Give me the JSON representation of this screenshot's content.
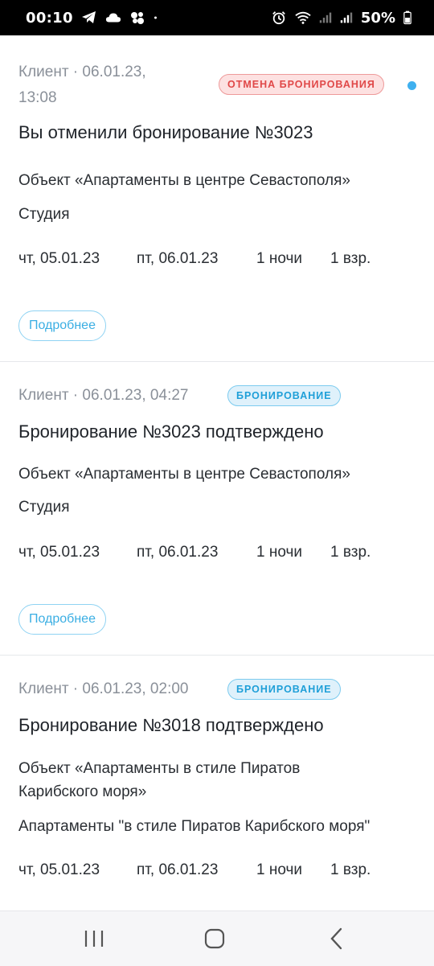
{
  "status_bar": {
    "time": "00:10",
    "battery": "50%",
    "left_icons": [
      "telegram-icon",
      "cloud-icon",
      "app-icon",
      "dot-icon"
    ],
    "right_icons": [
      "alarm-icon",
      "wifi-icon",
      "signal-icon",
      "signal-icon",
      "battery-icon"
    ]
  },
  "notifications": [
    {
      "meta": "Клиент · 06.01.23,",
      "meta_line2": "13:08",
      "badge": "ОТМЕНА БРОНИРОВАНИЯ",
      "badge_type": "cancel",
      "unread": true,
      "title": "Вы отменили бронирование №3023",
      "object": "Объект «Апартаменты в центре Севастополя»",
      "room": "Студия",
      "check_in": "чт, 05.01.23",
      "check_out": "пт, 06.01.23",
      "nights": "1 ночи",
      "guests": "1 взр.",
      "more_label": "Подробнее"
    },
    {
      "meta": "Клиент · 06.01.23, 04:27",
      "badge": "БРОНИРОВАНИЕ",
      "badge_type": "booking",
      "unread": false,
      "title": "Бронирование №3023 подтверждено",
      "object": "Объект «Апартаменты в центре Севастополя»",
      "room": "Студия",
      "check_in": "чт, 05.01.23",
      "check_out": "пт, 06.01.23",
      "nights": "1 ночи",
      "guests": "1 взр.",
      "more_label": "Подробнее"
    },
    {
      "meta": "Клиент · 06.01.23, 02:00",
      "badge": "БРОНИРОВАНИЕ",
      "badge_type": "booking",
      "unread": false,
      "title": "Бронирование №3018 подтверждено",
      "object": "Объект «Апартаменты в стиле Пиратов Карибского моря»",
      "room": "Апартаменты \"в стиле Пиратов Карибского моря\"",
      "check_in": "чт, 05.01.23",
      "check_out": "пт, 06.01.23",
      "nights": "1 ночи",
      "guests": "1 взр."
    }
  ],
  "nav_bar": {
    "icons": [
      "recent-apps-icon",
      "home-icon",
      "back-icon"
    ]
  },
  "colors": {
    "accent": "#3aaee3",
    "cancel_badge": "#e04848",
    "booking_badge": "#1e9fd8",
    "unread_dot": "#3fb0ef"
  }
}
